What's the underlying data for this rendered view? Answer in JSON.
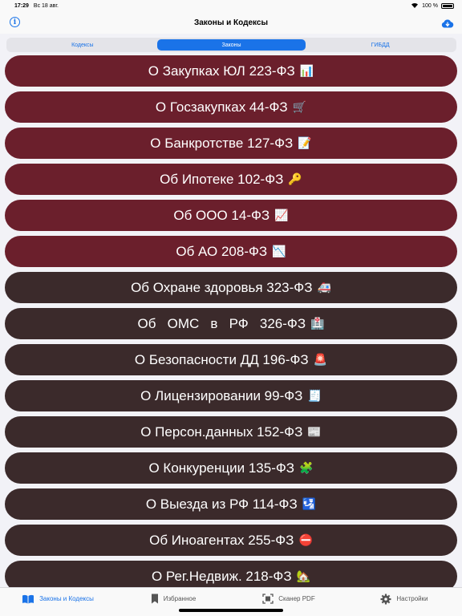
{
  "status": {
    "time": "17:29",
    "date": "Вс 18 авг.",
    "battery": "100 %"
  },
  "nav": {
    "title": "Законы и Кодексы"
  },
  "segments": [
    {
      "label": "Кодексы",
      "active": false
    },
    {
      "label": "Законы",
      "active": true
    },
    {
      "label": "ГИБДД",
      "active": false
    }
  ],
  "colors": {
    "accent": "#1a73e8",
    "law_red": "#6b1f2c",
    "law_dark": "#3b2a2b"
  },
  "laws": [
    {
      "title": "О Закупках ЮЛ 223-ФЗ",
      "emoji": "📊",
      "style": "red"
    },
    {
      "title": "О Госзакупках 44-ФЗ",
      "emoji": "🛒",
      "style": "red"
    },
    {
      "title": "О Банкротстве 127-ФЗ",
      "emoji": "📝",
      "style": "red"
    },
    {
      "title": "Об Ипотеке 102-ФЗ",
      "emoji": "🔑",
      "style": "red"
    },
    {
      "title": "Об ООО 14-ФЗ",
      "emoji": "📈",
      "style": "red"
    },
    {
      "title": "Об АО 208-ФЗ",
      "emoji": "📉",
      "style": "red"
    },
    {
      "title": "Об Охране здоровья 323-ФЗ",
      "emoji": "🚑",
      "style": "dark"
    },
    {
      "title": "Об   ОМС   в   РФ   326-ФЗ",
      "emoji": "🏥",
      "style": "dark"
    },
    {
      "title": "О Безопасности ДД 196-ФЗ",
      "emoji": "🚨",
      "style": "dark"
    },
    {
      "title": "О Лицензировании 99-ФЗ",
      "emoji": "🧾",
      "style": "dark"
    },
    {
      "title": "О Персон.данных 152-ФЗ",
      "emoji": "📰",
      "style": "dark"
    },
    {
      "title": "О Конкуренции 135-ФЗ",
      "emoji": "🧩",
      "style": "dark"
    },
    {
      "title": "О Выезда из РФ 114-ФЗ",
      "emoji": "🛂",
      "style": "dark"
    },
    {
      "title": "Об Иноагентах 255-ФЗ",
      "emoji": "⛔",
      "style": "dark"
    },
    {
      "title": "О Рег.Недвиж. 218-ФЗ",
      "emoji": "🏡",
      "style": "dark"
    }
  ],
  "tabs": [
    {
      "label": "Законы и Кодексы",
      "icon": "book-icon",
      "active": true
    },
    {
      "label": "Избранное",
      "icon": "bookmark-icon",
      "active": false
    },
    {
      "label": "Сканер PDF",
      "icon": "scanner-icon",
      "active": false
    },
    {
      "label": "Настройки",
      "icon": "gear-icon",
      "active": false
    }
  ]
}
